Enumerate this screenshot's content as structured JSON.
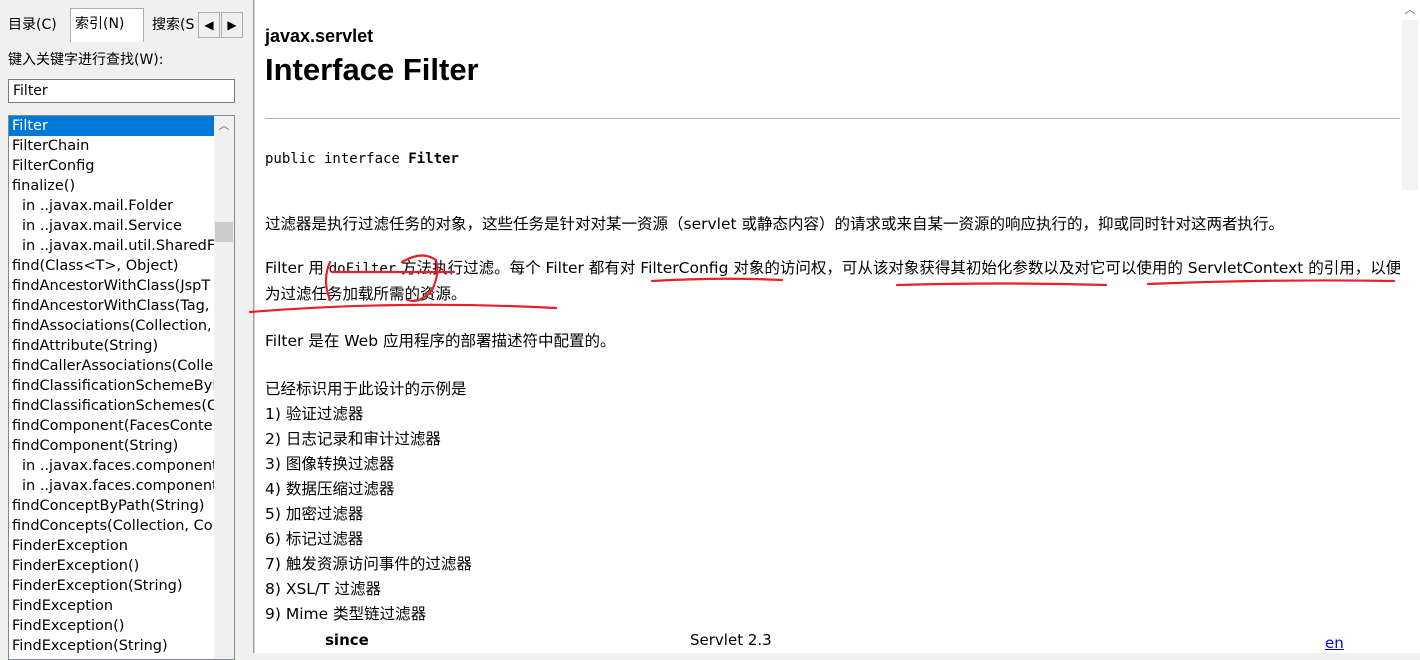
{
  "tabs": {
    "contents": "目录(C)",
    "index": "索引(N)",
    "search": "搜索(S"
  },
  "index_pane": {
    "keyword_label": "键入关键字进行查找(W):",
    "search_value": "Filter",
    "items": [
      {
        "text": "Filter",
        "indent": false,
        "selected": true
      },
      {
        "text": "FilterChain",
        "indent": false
      },
      {
        "text": "FilterConfig",
        "indent": false
      },
      {
        "text": "finalize()",
        "indent": false
      },
      {
        "text": "in ..javax.mail.Folder",
        "indent": true
      },
      {
        "text": "in ..javax.mail.Service",
        "indent": true
      },
      {
        "text": "in ..javax.mail.util.SharedFil",
        "indent": true
      },
      {
        "text": "find(Class<T>, Object)",
        "indent": false
      },
      {
        "text": "findAncestorWithClass(JspT",
        "indent": false
      },
      {
        "text": "findAncestorWithClass(Tag,",
        "indent": false
      },
      {
        "text": "findAssociations(Collection,",
        "indent": false
      },
      {
        "text": "findAttribute(String)",
        "indent": false
      },
      {
        "text": "findCallerAssociations(Colle",
        "indent": false
      },
      {
        "text": "findClassificationSchemeByN",
        "indent": false
      },
      {
        "text": "findClassificationSchemes(C",
        "indent": false
      },
      {
        "text": "findComponent(FacesConte",
        "indent": false
      },
      {
        "text": "findComponent(String)",
        "indent": false
      },
      {
        "text": "in ..javax.faces.component",
        "indent": true
      },
      {
        "text": "in ..javax.faces.component",
        "indent": true
      },
      {
        "text": "findConceptByPath(String)",
        "indent": false
      },
      {
        "text": "findConcepts(Collection, Co",
        "indent": false
      },
      {
        "text": "FinderException",
        "indent": false
      },
      {
        "text": "FinderException()",
        "indent": false
      },
      {
        "text": "FinderException(String)",
        "indent": false
      },
      {
        "text": "FindException",
        "indent": false
      },
      {
        "text": "FindException()",
        "indent": false
      },
      {
        "text": "FindException(String)",
        "indent": false
      }
    ]
  },
  "doc": {
    "package": "javax.servlet",
    "title": "Interface Filter",
    "signature_prefix": "public interface ",
    "signature_name": "Filter",
    "p1": "过滤器是执行过滤任务的对象，这些任务是针对对某一资源（servlet 或静态内容）的请求或来自某一资源的响应执行的，抑或同时针对这两者执行。",
    "p2_a": "Filter 用 ",
    "p2_code": "doFilter",
    "p2_b": " 方法执行过滤。每个 Filter 都有对 FilterConfig 对象的访问权，可从该对象获得其初始化参数以及对它可以使用的 ServletContext 的引用，以便为过滤任务加载所需的资源。",
    "p3": "Filter 是在 Web 应用程序的部署描述符中配置的。",
    "examples_intro": "已经标识用于此设计的示例是",
    "examples": [
      "1) 验证过滤器",
      "2) 日志记录和审计过滤器",
      "3) 图像转换过滤器",
      "4) 数据压缩过滤器",
      "5) 加密过滤器",
      "6) 标记过滤器",
      "7) 触发资源访问事件的过滤器",
      "8) XSL/T 过滤器",
      "9) Mime 类型链过滤器"
    ],
    "since_label": "since",
    "since_value": "Servlet 2.3",
    "lang_link": "en"
  },
  "colors": {
    "selection": "#0078d7",
    "annotation": "#e8202a",
    "link": "#0000ee"
  }
}
